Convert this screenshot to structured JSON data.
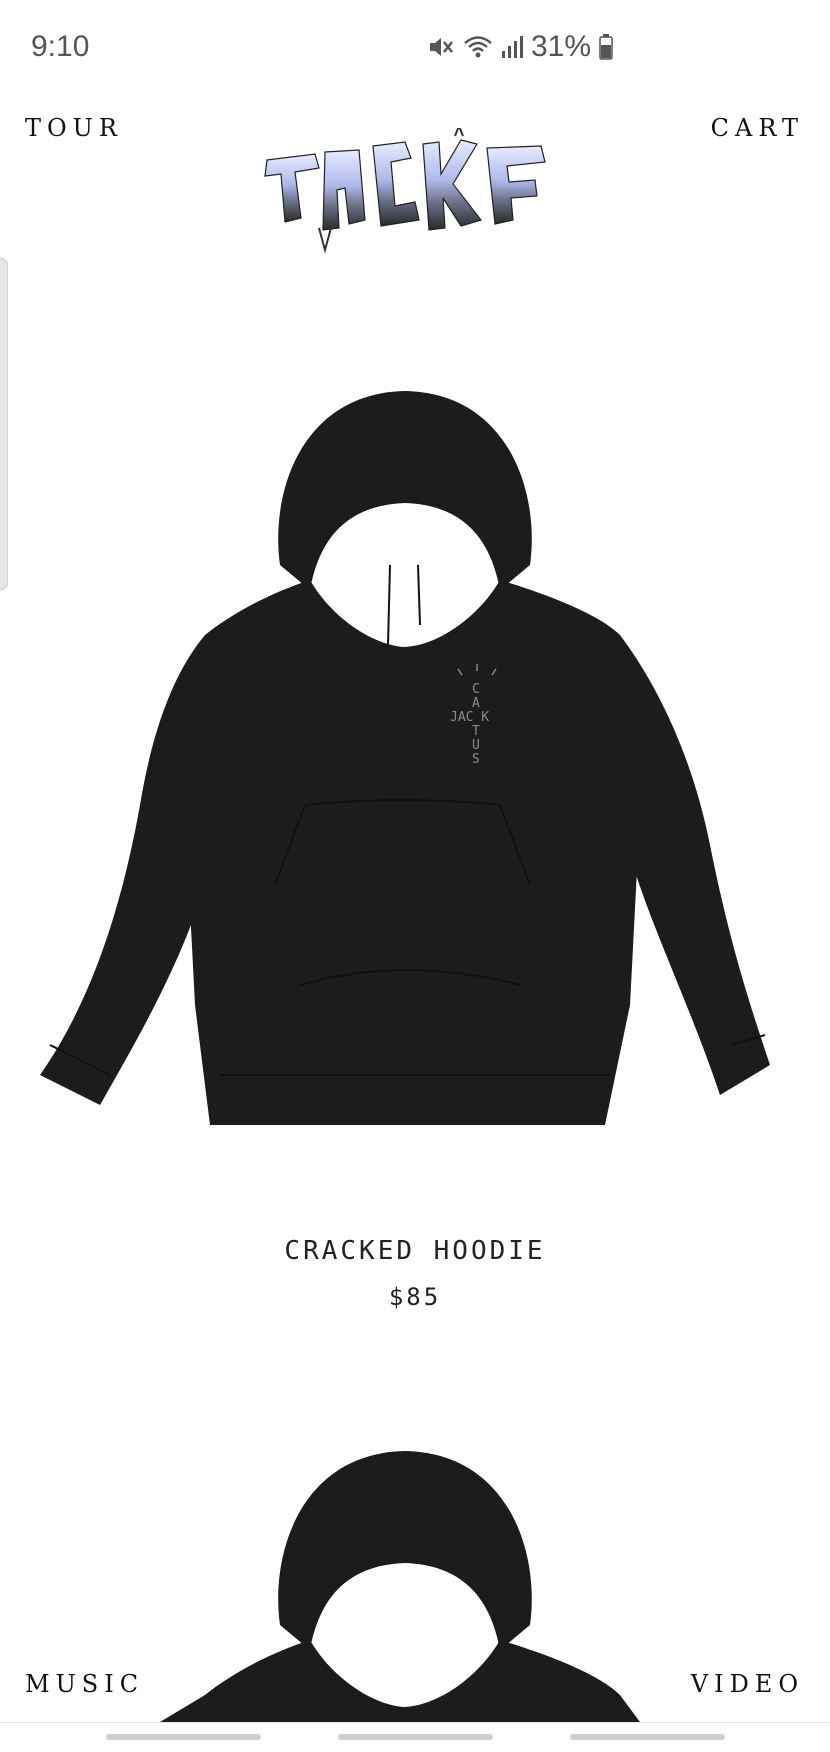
{
  "status_bar": {
    "time": "9:10",
    "battery_percent": "31%",
    "icons": [
      "mute-icon",
      "wifi-icon",
      "signal-icon",
      "battery-icon"
    ]
  },
  "nav": {
    "tour": "TOUR",
    "cart": "CART",
    "music": "MUSIC",
    "video": "VIDEO"
  },
  "logo": {
    "name": "jackboys-logo",
    "text": "JACKBOYS"
  },
  "products": [
    {
      "name": "CRACKED HOODIE",
      "price": "$85",
      "graphic_text": "CACTUS JACK"
    }
  ],
  "colors": {
    "background": "#ffffff",
    "hoodie": "#1c1c1c",
    "text": "#222222"
  }
}
